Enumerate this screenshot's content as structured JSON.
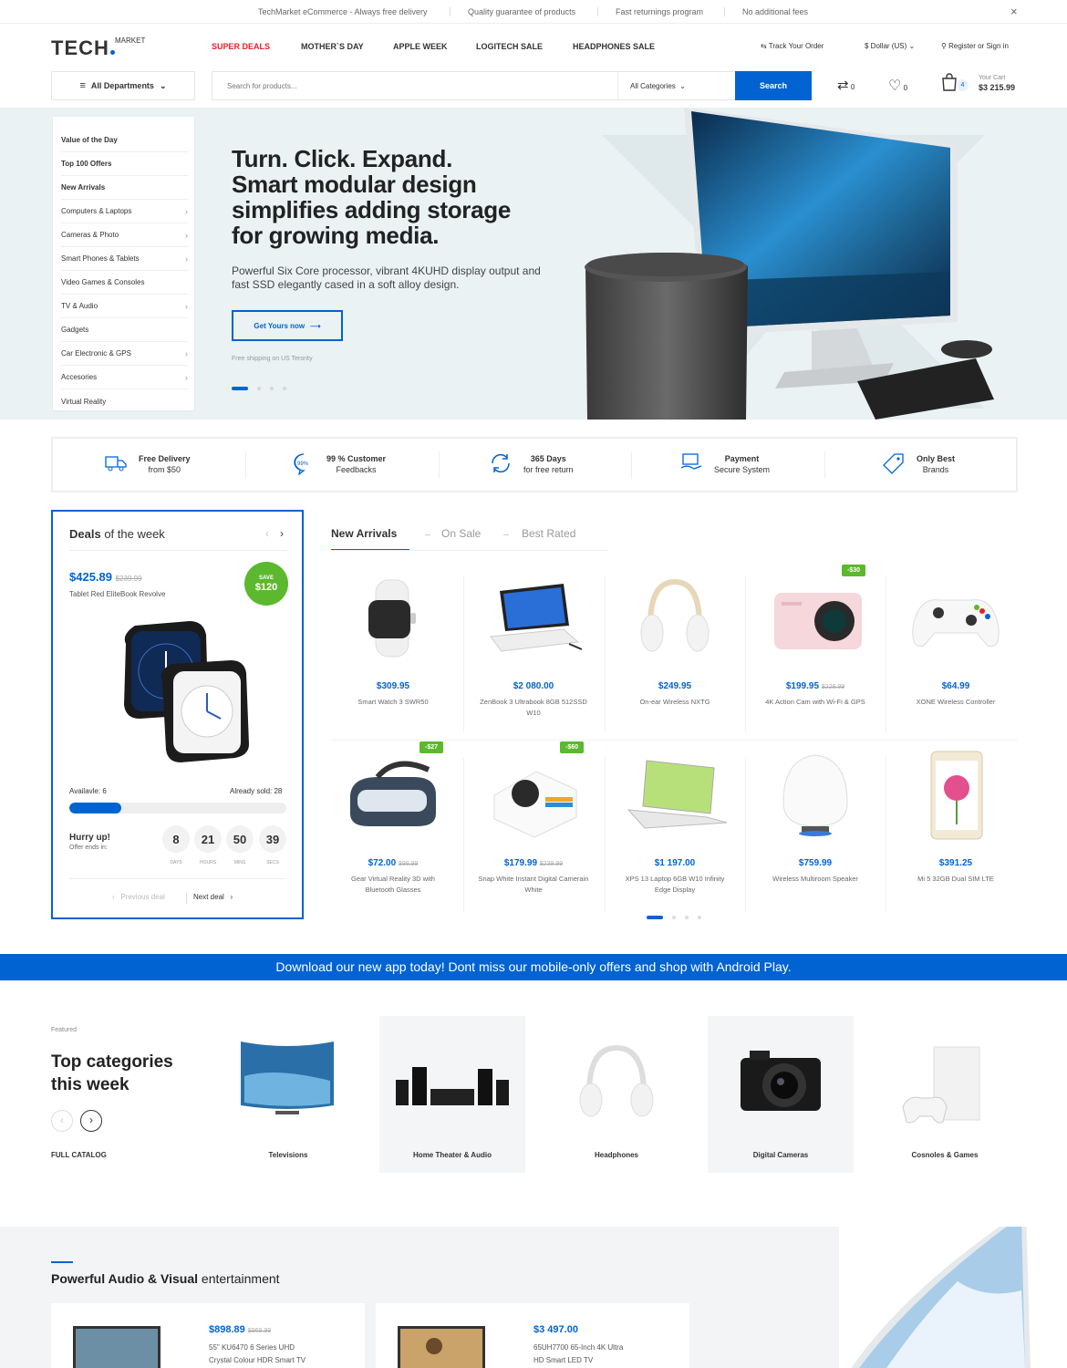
{
  "topbar": {
    "items": [
      "TechMarket eCommerce - Always free delivery",
      "Quality guarantee of products",
      "Fast returnings program",
      "No additional fees"
    ],
    "close": "×"
  },
  "header": {
    "logo_main": "TECH",
    "logo_sup": "MARKET",
    "nav": [
      "SUPER DEALS",
      "MOTHER`S DAY",
      "APPLE WEEK",
      "LOGITECH SALE",
      "HEADPHONES SALE"
    ],
    "track_order": "Track Your Order",
    "currency": "$ Dollar (US)",
    "account": "Register or Sign in",
    "departments": "All Departments",
    "search_placeholder": "Search for products...",
    "search_category": "All Categories",
    "search_button": "Search",
    "compare_count": "0",
    "wishlist_count": "0",
    "cart_count": "4",
    "cart_label": "Your Cart",
    "cart_total": "$3 215.99"
  },
  "menu": [
    {
      "label": "Value of the Day",
      "bold": true,
      "arrow": false
    },
    {
      "label": "Top 100 Offers",
      "bold": true,
      "arrow": false
    },
    {
      "label": "New Arrivals",
      "bold": true,
      "arrow": false
    },
    {
      "label": "Computers & Laptops",
      "bold": false,
      "arrow": true
    },
    {
      "label": "Cameras & Photo",
      "bold": false,
      "arrow": true
    },
    {
      "label": "Smart Phones & Tablets",
      "bold": false,
      "arrow": true
    },
    {
      "label": "Video Games & Consoles",
      "bold": false,
      "arrow": false
    },
    {
      "label": "TV & Audio",
      "bold": false,
      "arrow": true
    },
    {
      "label": "Gadgets",
      "bold": false,
      "arrow": false
    },
    {
      "label": "Car Electronic & GPS",
      "bold": false,
      "arrow": true
    },
    {
      "label": "Accesories",
      "bold": false,
      "arrow": true
    },
    {
      "label": "Virtual Reality",
      "bold": false,
      "arrow": false
    }
  ],
  "hero": {
    "title_lines": [
      "Turn. Click. Expand.",
      "Smart modular design",
      "simplifies adding storage",
      "for growing media."
    ],
    "subtitle": "Powerful Six Core processor, vibrant 4KUHD display output and fast SSD elegantly cased in a soft alloy design.",
    "button": "Get Yours now",
    "note": "Free shipping on US Terority"
  },
  "features": [
    {
      "bold": "Free Delivery",
      "text": "from $50",
      "icon": "truck-icon"
    },
    {
      "bold": "99 % Customer",
      "text": "Feedbacks",
      "icon": "feedback-icon"
    },
    {
      "bold": "365 Days",
      "text": "for free return",
      "icon": "return-icon"
    },
    {
      "bold": "Payment",
      "text": "Secure System",
      "icon": "payment-icon"
    },
    {
      "bold": "Only Best",
      "text": "Brands",
      "icon": "tag-icon"
    }
  ],
  "deals": {
    "title_bold": "Deals",
    "title_rest": " of the week",
    "price": "$425.89",
    "old_price": "$239.99",
    "name": "Tablet Red EliteBook Revolve",
    "save_label": "SAVE",
    "save_amount": "$120",
    "available": "Availavle: 6",
    "sold": "Already sold: 28",
    "sold_fraction": 0.24,
    "hurry": "Hurry up!",
    "offer_ends": "Offer ends in:",
    "countdown": [
      {
        "value": "8",
        "label": "DAYS"
      },
      {
        "value": "21",
        "label": "HOURS"
      },
      {
        "value": "50",
        "label": "MINS"
      },
      {
        "value": "39",
        "label": "SECS"
      }
    ],
    "prev": "Previous deal",
    "next": "Next deal"
  },
  "tabs": [
    "New Arrivals",
    "On Sale",
    "Best Rated"
  ],
  "products": [
    {
      "price": "$309.95",
      "old": "",
      "name": "Smart Watch 3 SWR50",
      "badge": "",
      "icon": "smartwatch-icon"
    },
    {
      "price": "$2 080.00",
      "old": "",
      "name": "ZenBook 3 Ultrabook 8GB 512SSD W10",
      "badge": "",
      "icon": "tablet-laptop-icon"
    },
    {
      "price": "$249.95",
      "old": "",
      "name": "On-ear Wireless NXTG",
      "badge": "",
      "icon": "headphones-icon"
    },
    {
      "price": "$199.95",
      "old": "$229.99",
      "name": "4K Action Cam with Wi-Fi & GPS",
      "badge": "-$30",
      "icon": "action-cam-icon"
    },
    {
      "price": "$64.99",
      "old": "",
      "name": "XONE Wireless Controller",
      "badge": "",
      "icon": "gamepad-icon"
    },
    {
      "price": "$72.00",
      "old": "$99.99",
      "name": "Gear Virtual Reality 3D with Bluetooth Glasses",
      "badge": "-$27",
      "icon": "vr-headset-icon"
    },
    {
      "price": "$179.99",
      "old": "$239.99",
      "name": "Snap White Instant Digital Camerain White",
      "badge": "-$60",
      "icon": "instant-camera-icon"
    },
    {
      "price": "$1 197.00",
      "old": "",
      "name": "XPS 13 Laptop 6GB W10 Infinity Edge Display",
      "badge": "",
      "icon": "laptop-icon"
    },
    {
      "price": "$759.99",
      "old": "",
      "name": "Wireless Multiroom Speaker",
      "badge": "",
      "icon": "speaker-icon"
    },
    {
      "price": "$391.25",
      "old": "",
      "name": "Mi 5 32GB Dual SIM LTE",
      "badge": "",
      "icon": "smartphone-icon"
    }
  ],
  "banner": "Download our new app today! Dont miss our mobile-only offers and shop with Android Play.",
  "categories": {
    "eyebrow": "Featured",
    "title_line1": "Top categories",
    "title_line2": "this week",
    "full_catalog": "FULL CATALOG",
    "items": [
      {
        "label": "Televisions",
        "icon": "tv-icon"
      },
      {
        "label": "Home Theater & Audio",
        "icon": "home-theater-icon"
      },
      {
        "label": "Headphones",
        "icon": "headphones-icon"
      },
      {
        "label": "Digital Cameras",
        "icon": "camera-icon"
      },
      {
        "label": "Cosnoles & Games",
        "icon": "console-icon"
      }
    ]
  },
  "powerful": {
    "title_bold": "Powerful Audio & Visual",
    "title_rest": " entertainment",
    "cards": [
      {
        "price": "$898.89",
        "old": "$969.99",
        "line1": "55\" KU6470 6 Series UHD",
        "line2": "Crystal Colour HDR Smart TV"
      },
      {
        "price": "$3 497.00",
        "old": "",
        "line1": "65UH7700 65-Inch 4K Ultra",
        "line2": "HD Smart LED TV"
      }
    ]
  },
  "colors": {
    "accent": "#0063d1",
    "sale_red": "#e4202b",
    "badge_green": "#5cb82e"
  }
}
